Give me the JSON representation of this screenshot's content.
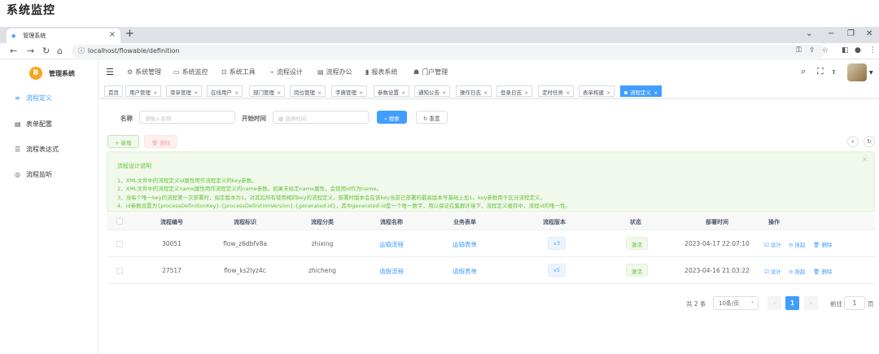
{
  "heading": "系统监控",
  "browser": {
    "tab_title": "管理系统",
    "tab_close": "×",
    "new_tab": "+",
    "url": "localhost/flowable/definition",
    "win_min": "−",
    "win_restore": "❐",
    "win_close": "✕",
    "win_dropdown": "⌄"
  },
  "sidebar": {
    "logo_char": "B",
    "title": "管理系统",
    "items": [
      {
        "label": "流程定义",
        "icon": "≡"
      },
      {
        "label": "表单配置",
        "icon": "▤"
      },
      {
        "label": "流程表达式",
        "icon": "☰"
      },
      {
        "label": "流程监听",
        "icon": "◎"
      }
    ]
  },
  "topnav": {
    "menus": [
      {
        "label": "系统管理",
        "icon": "⚙"
      },
      {
        "label": "系统监控",
        "icon": "▭"
      },
      {
        "label": "系统工具",
        "icon": "⊡"
      },
      {
        "label": "流程设计",
        "icon": "⌁"
      },
      {
        "label": "流程办公",
        "icon": "▤"
      },
      {
        "label": "报表系统",
        "icon": "▮"
      },
      {
        "label": "门户管理",
        "icon": "☗"
      }
    ]
  },
  "tags": [
    {
      "label": "首页"
    },
    {
      "label": "用户管理"
    },
    {
      "label": "菜单管理"
    },
    {
      "label": "在线用户"
    },
    {
      "label": "部门管理"
    },
    {
      "label": "岗位管理"
    },
    {
      "label": "字典管理"
    },
    {
      "label": "参数设置"
    },
    {
      "label": "通知公告"
    },
    {
      "label": "操作日志"
    },
    {
      "label": "登录日志"
    },
    {
      "label": "定时任务"
    },
    {
      "label": "表单构建"
    },
    {
      "label": "流程定义"
    }
  ],
  "search": {
    "name_label": "名称",
    "name_placeholder": "请输入名称",
    "time_label": "开始时间",
    "time_placeholder": "选择时间",
    "search_btn": "搜索",
    "reset_btn": "重置",
    "add_btn": "新增",
    "delete_btn": "删除"
  },
  "alert": {
    "title": "流程设计说明",
    "lines": [
      "1、XML文件中的流程定义id属性用作流程定义的key参数。",
      "2、XML文件中的流程定义name属性用作流程定义的name参数。如果未给定name属性，会使用id作为name。",
      "3、当每个唯一key的流程第一次部署时，指定版本为1。对其后所有使用相同key的流程定义，部署时版本会在该key当前已部署的最高版本号基础上加1。key参数用于区分流程定义。",
      "4、id参数设置为{processDefinitionKey}:{processDefinitionVersion}:{generated-id}，其中generated-id是一个唯一数字，用以保证在集群环境下，流程定义缓存中，流程id的唯一性。"
    ]
  },
  "table": {
    "headers": [
      "流程编号",
      "流程标识",
      "流程分类",
      "流程名称",
      "业务表单",
      "流程版本",
      "状态",
      "部署时间",
      "操作"
    ],
    "rows": [
      {
        "id": "30051",
        "key": "flow_z6dbfv8a",
        "category": "zhixing",
        "name": "运输流程",
        "form": "运输表单",
        "version": "v3",
        "status": "激活",
        "time": "2023-04-17 22:07:10"
      },
      {
        "id": "27517",
        "key": "flow_ks2lyz4c",
        "category": "zhicheng",
        "name": "请假流程",
        "form": "请假表单",
        "version": "v5",
        "status": "激活",
        "time": "2023-04-16 21:03:22"
      }
    ],
    "ops": {
      "design": "设计",
      "suspend": "挂起",
      "delete": "删除"
    }
  },
  "pagination": {
    "total": "共 2 条",
    "page_size": "10条/页",
    "prev": "‹",
    "current": "1",
    "next": "›",
    "goto": "前往",
    "goto_value": "1",
    "page_unit": "页"
  },
  "colors": {
    "primary": "#409eff",
    "success": "#67c23a",
    "danger": "#f56c6c"
  }
}
